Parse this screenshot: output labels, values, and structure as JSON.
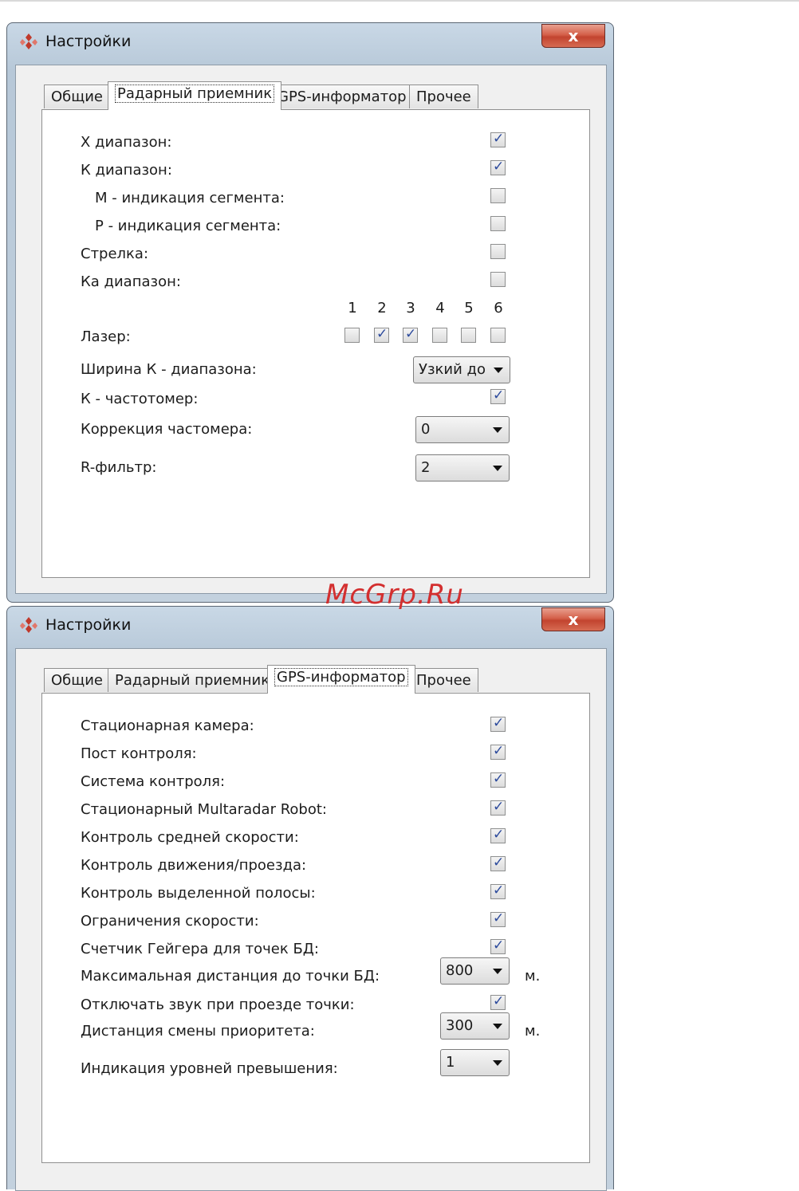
{
  "watermark": "McGrp.Ru",
  "window1": {
    "title": "Настройки",
    "close": "x",
    "tabs": [
      "Общие",
      "Радарный приемник",
      "GPS-информатор",
      "Прочее"
    ],
    "active_tab": "Радарный приемник",
    "rows": {
      "x_band": {
        "label": "X диапазон:",
        "checked": true
      },
      "k_band": {
        "label": "К диапазон:",
        "checked": true
      },
      "m_segment": {
        "label": "M - индикация сегмента:",
        "checked": false
      },
      "p_segment": {
        "label": "P - индикация сегмента:",
        "checked": false
      },
      "arrow": {
        "label": "Стрелка:",
        "checked": false
      },
      "ka_band": {
        "label": "Ка диапазон:",
        "checked": false
      },
      "laser": {
        "label": "Лазер:",
        "numbers": [
          "1",
          "2",
          "3",
          "4",
          "5",
          "6"
        ],
        "checked": [
          false,
          true,
          true,
          false,
          false,
          false
        ]
      },
      "k_width": {
        "label": "Ширина К - диапазона:",
        "value": "Узкий до"
      },
      "k_freq": {
        "label": "К - частотомер:",
        "checked": true
      },
      "freq_correction": {
        "label": "Коррекция частомера:",
        "value": "0"
      },
      "r_filter": {
        "label": "R-фильтр:",
        "value": "2"
      }
    }
  },
  "window2": {
    "title": "Настройки",
    "close": "x",
    "tabs": [
      "Общие",
      "Радарный приемник",
      "GPS-информатор",
      "Прочее"
    ],
    "active_tab": "GPS-информатор",
    "rows": {
      "stationary_camera": {
        "label": "Стационарная камера:",
        "checked": true
      },
      "control_post": {
        "label": "Пост контроля:",
        "checked": true
      },
      "control_system": {
        "label": "Система контроля:",
        "checked": true
      },
      "multaradar": {
        "label": "Стационарный Multaradar Robot:",
        "checked": true
      },
      "avg_speed": {
        "label": "Контроль средней скорости:",
        "checked": true
      },
      "traffic_control": {
        "label": "Контроль движения/проезда:",
        "checked": true
      },
      "lane_control": {
        "label": "Контроль выделенной полосы:",
        "checked": true
      },
      "speed_limits": {
        "label": "Ограничения скорости:",
        "checked": true
      },
      "geiger": {
        "label": "Счетчик Гейгера для точек БД:",
        "checked": true
      },
      "max_distance": {
        "label": "Максимальная дистанция до точки БД:",
        "value": "800",
        "unit": "м."
      },
      "mute_on_pass": {
        "label": "Отключать звук при проезде точки:",
        "checked": true
      },
      "priority_distance": {
        "label": "Дистанция смены приоритета:",
        "value": "300",
        "unit": "м."
      },
      "excess_levels": {
        "label": "Индикация уровней превышения:",
        "value": "1"
      }
    }
  }
}
